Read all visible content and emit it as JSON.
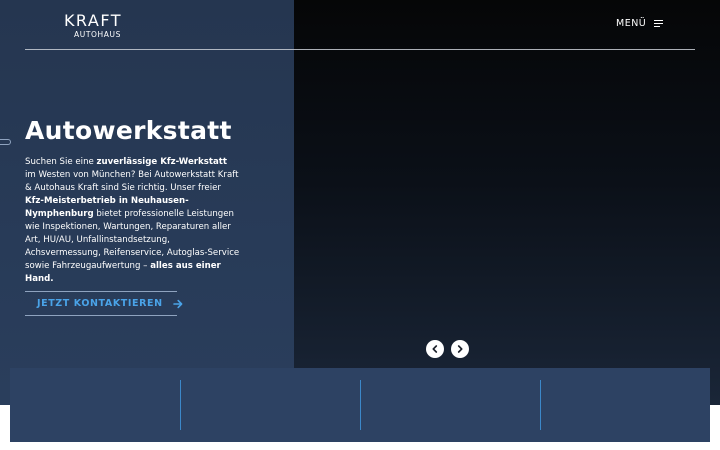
{
  "brand": {
    "name": "KRAFT",
    "sub": "AUTOHAUS"
  },
  "header": {
    "menu_label": "MENÜ"
  },
  "hero": {
    "title": "Autowerkstatt",
    "text": {
      "p1": "Suchen Sie eine ",
      "b1": "zuverlässige Kfz-Werkstatt",
      "p2": " im Westen von München? Bei Autowerkstatt Kraft & Autohaus Kraft sind Sie richtig. Unser freier ",
      "b2": "Kfz-Meisterbetrieb in Neuhausen-Nymphenburg",
      "p3": " bietet professionelle Leistungen wie Inspektionen, Wartungen, Reparaturen aller Art, HU/AU, Unfallinstandsetzung, Achsvermessung, Reifenservice, Autoglas-Service sowie Fahrzeugaufwertung – ",
      "b3": "alles aus einer Hand."
    },
    "cta_label": "JETZT KONTAKTIEREN"
  },
  "slider": {
    "prev_icon": "chevron-left-icon",
    "next_icon": "chevron-right-icon"
  },
  "colors": {
    "panel": "#283b58",
    "accent": "#4aa3e8",
    "info_bar": "#2d4263"
  }
}
